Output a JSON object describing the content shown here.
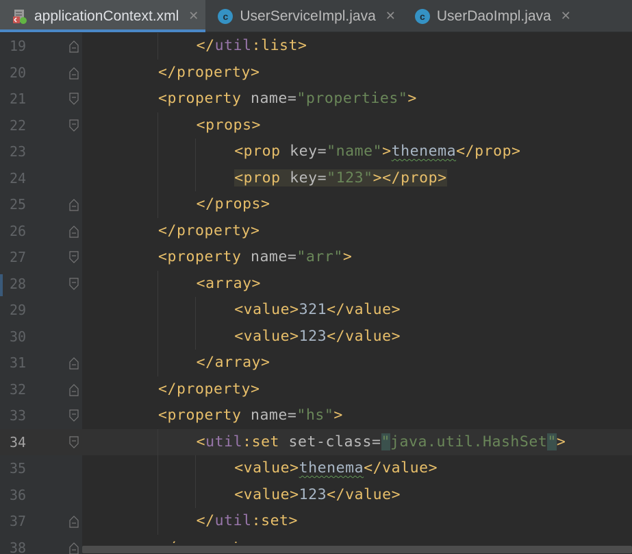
{
  "tabs": [
    {
      "label": "applicationContext.xml",
      "icon": "xml-file-icon",
      "active": true
    },
    {
      "label": "UserServiceImpl.java",
      "icon": "java-class-icon",
      "active": false
    },
    {
      "label": "UserDaoImpl.java",
      "icon": "java-class-icon",
      "active": false
    }
  ],
  "editor": {
    "current_line": "34",
    "lines": [
      {
        "num": "19",
        "t1": "</",
        "ns": "util",
        "t2": ":list>"
      },
      {
        "num": "20",
        "t1": "</property>"
      },
      {
        "num": "21",
        "t1": "<property",
        "a1": " name=",
        "v1": "\"properties\"",
        "t2": ">"
      },
      {
        "num": "22",
        "t1": "<props>"
      },
      {
        "num": "23",
        "t1": "<prop",
        "a1": " key=",
        "v1": "\"name\"",
        "t2": ">",
        "tx": "thenema",
        "t3": "</prop>"
      },
      {
        "num": "24",
        "t1": "<prop",
        "a1": " key=",
        "v1": "\"123\"",
        "t2": "></prop>"
      },
      {
        "num": "25",
        "t1": "</props>"
      },
      {
        "num": "26",
        "t1": "</property>"
      },
      {
        "num": "27",
        "t1": "<property",
        "a1": " name=",
        "v1": "\"arr\"",
        "t2": ">"
      },
      {
        "num": "28",
        "t1": "<array>"
      },
      {
        "num": "29",
        "t1": "<value>",
        "tx": "321",
        "t2": "</value>"
      },
      {
        "num": "30",
        "t1": "<value>",
        "tx": "123",
        "t2": "</value>"
      },
      {
        "num": "31",
        "t1": "</array>"
      },
      {
        "num": "32",
        "t1": "</property>"
      },
      {
        "num": "33",
        "t1": "<property",
        "a1": " name=",
        "v1": "\"hs\"",
        "t2": ">"
      },
      {
        "num": "34",
        "t1": "<",
        "ns": "util",
        "t2": ":set",
        "a1": " set-class=",
        "q1": "\"",
        "v1": "java.util.",
        "ns2": "HashSet",
        "q2": "\"",
        "t3": ">"
      },
      {
        "num": "35",
        "t1": "<value>",
        "tx": "thenema",
        "t2": "</value>"
      },
      {
        "num": "36",
        "t1": "<value>",
        "tx": "123",
        "t2": "</value>"
      },
      {
        "num": "37",
        "t1": "</",
        "ns": "util",
        "t2": ":set>"
      },
      {
        "num": "38",
        "t1": "</property>"
      }
    ]
  },
  "colors": {
    "tag": "#e8bf6a",
    "attribute": "#bababa",
    "value": "#6a8759",
    "namespace": "#9876aa",
    "text": "#a9b7c6",
    "background": "#2b2b2b",
    "tab_underline": "#4a88c7"
  }
}
